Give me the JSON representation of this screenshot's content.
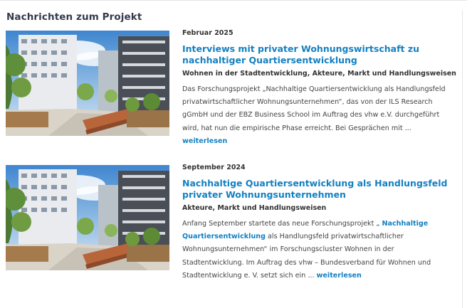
{
  "section": {
    "title": "Nachrichten zum Projekt"
  },
  "colors": {
    "accent": "#1480c1",
    "title": "#333a4d",
    "text": "#444444"
  },
  "news": [
    {
      "date": "Februar 2025",
      "headline": "Interviews mit privater Wohnungswirtschaft zu nachhaltiger Quartiersentwicklung",
      "tags": "Wohnen in der Stadtentwicklung, Akteure, Markt und Handlungsweisen",
      "excerpt": "Das Forschungsprojekt „Nachhaltige Quartiersentwicklung als Handlungsfeld privatwirtschaftlicher Wohnungsunternehmen“, das von der ILS Research gGmbH und der EBZ Business School im Auftrag des vhw e.V. durchgeführt wird, hat nun die empirische Phase erreicht. Bei Gesprächen mit",
      "ellipsis": " ... ",
      "more_label": "weiterlesen",
      "image_alt": "photo-modern-residential-quarter"
    },
    {
      "date": "September 2024",
      "headline": "Nachhaltige Quartiersentwicklung als Handlungsfeld privater Wohnungsunternehmen",
      "tags": "Akteure, Markt und Handlungsweisen",
      "excerpt_before": "Anfang September startete das neue Forschungsprojekt „ ",
      "excerpt_link": "Nachhaltige Quartiersentwicklung",
      "excerpt_after": " als Handlungsfeld privatwirtschaftlicher Wohnungsunternehmen“ im Forschungscluster Wohnen in der Stadtentwicklung. Im Auftrag des vhw – Bundesverband für Wohnen und Stadtentwicklung e. V. setzt sich ein",
      "ellipsis": " ... ",
      "more_label": "weiterlesen",
      "image_alt": "photo-modern-residential-quarter"
    }
  ]
}
